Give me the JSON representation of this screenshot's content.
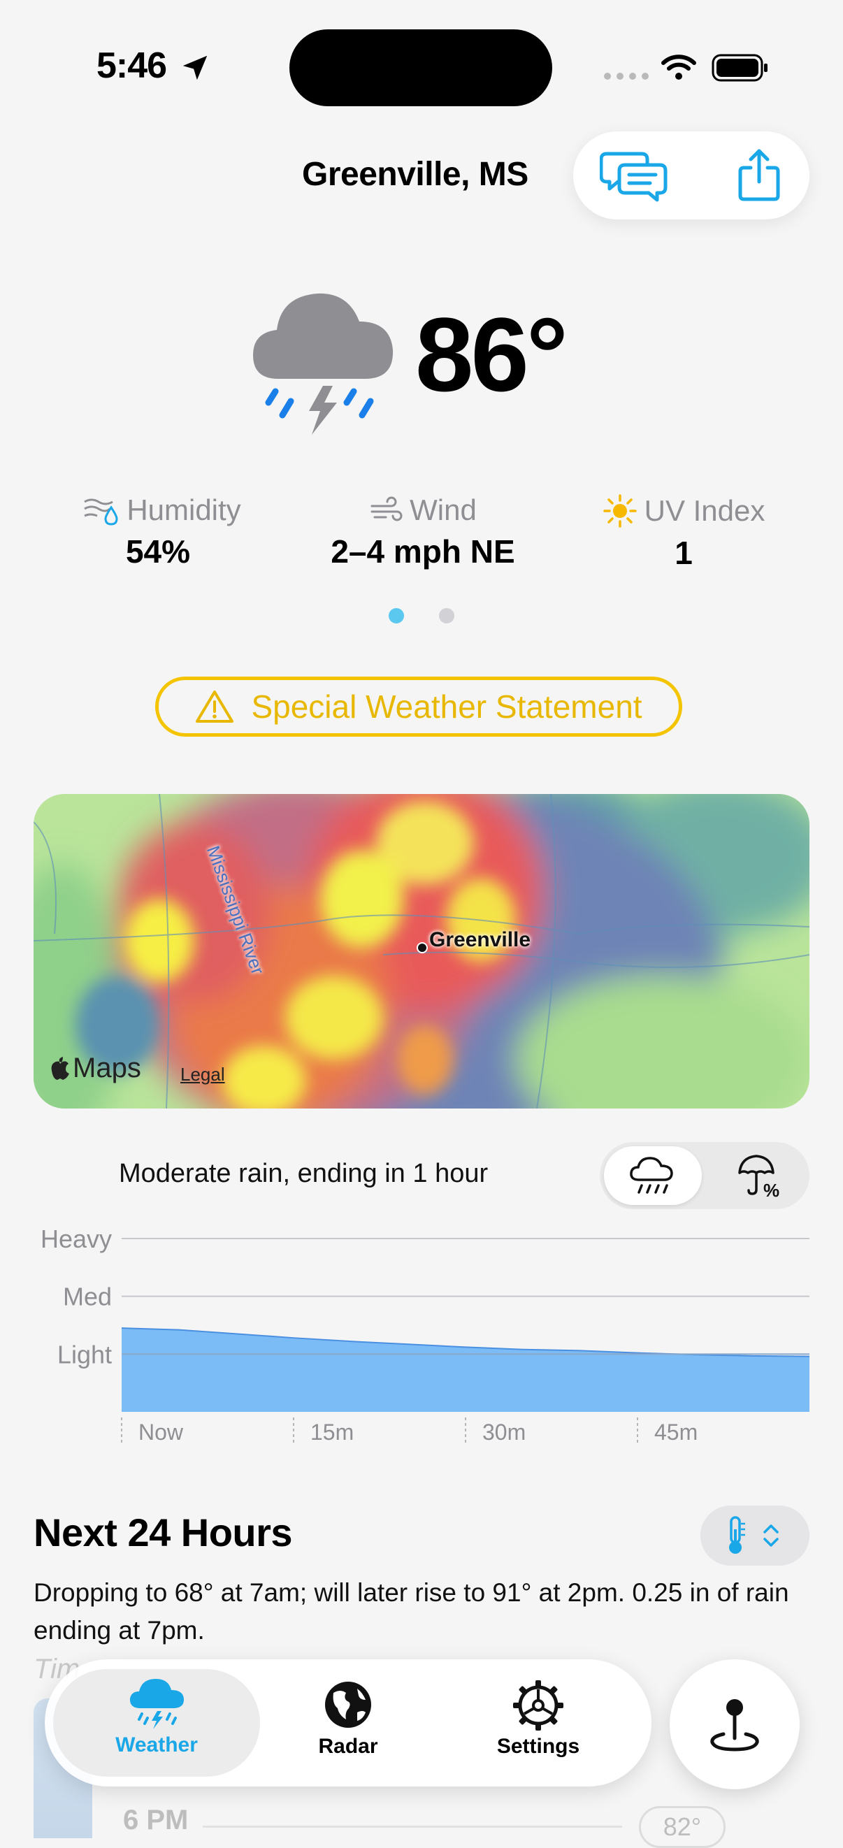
{
  "status_bar": {
    "time": "5:46"
  },
  "header": {
    "location": "Greenville, MS"
  },
  "current": {
    "temperature": "86°",
    "metrics": [
      {
        "label": "Humidity",
        "value": "54%"
      },
      {
        "label": "Wind",
        "value": "2–4 mph NE"
      },
      {
        "label": "UV Index",
        "value": "1"
      }
    ],
    "pager": {
      "pages": 2,
      "active": 1
    }
  },
  "alert": {
    "label": "Special Weather Statement"
  },
  "map": {
    "river_label": "Mississippi River",
    "city_label": "Greenville",
    "maps_brand": "Maps",
    "legal_link": "Legal"
  },
  "precip": {
    "summary": "Moderate rain, ending in 1 hour",
    "levels": [
      "Heavy",
      "Med",
      "Light"
    ],
    "ticks": [
      "Now",
      "15m",
      "30m",
      "45m"
    ]
  },
  "next24": {
    "title": "Next 24 Hours",
    "summary": "Dropping to 68° at 7am; will later rise to 91° at 2pm. 0.25 in of rain ending at 7pm.",
    "partial_label": "Tim",
    "partial_hour": "6 PM",
    "partial_temp": "82°"
  },
  "tabs": [
    {
      "label": "Weather",
      "active": true
    },
    {
      "label": "Radar",
      "active": false
    },
    {
      "label": "Settings",
      "active": false
    }
  ],
  "colors": {
    "accent": "#1aa7e8",
    "alert": "#f5c400",
    "rain_fill": "#7bbcf7",
    "rain_line": "#4a8fe0"
  },
  "chart_data": {
    "type": "area",
    "x": [
      0,
      5,
      10,
      15,
      20,
      25,
      30,
      35,
      40,
      45,
      50,
      55,
      60
    ],
    "values": [
      1.45,
      1.42,
      1.35,
      1.28,
      1.22,
      1.17,
      1.12,
      1.08,
      1.06,
      1.02,
      0.99,
      0.97,
      0.96
    ],
    "ylim": [
      0,
      3
    ],
    "y_levels": [
      {
        "label": "Light",
        "value": 1
      },
      {
        "label": "Med",
        "value": 2
      },
      {
        "label": "Heavy",
        "value": 3
      }
    ],
    "x_ticks": [
      {
        "label": "Now",
        "value": 0
      },
      {
        "label": "15m",
        "value": 15
      },
      {
        "label": "30m",
        "value": 30
      },
      {
        "label": "45m",
        "value": 45
      }
    ],
    "grid": true
  }
}
